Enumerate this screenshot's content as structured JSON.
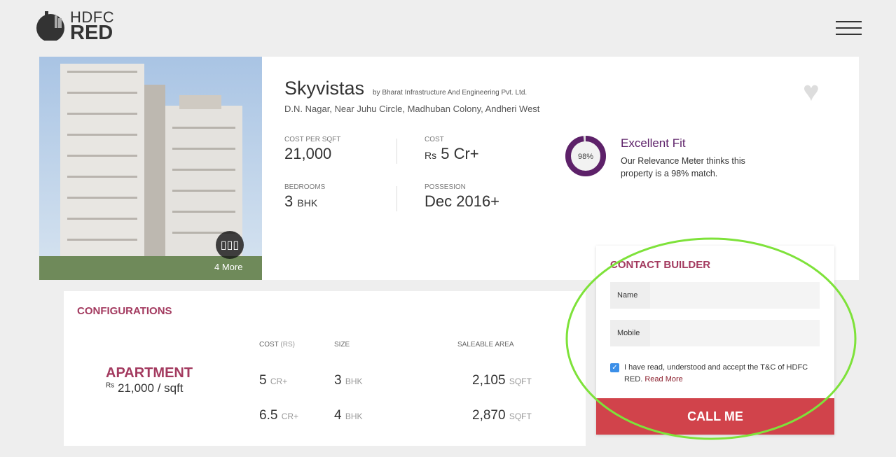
{
  "header": {
    "logo_line1": "HDFC",
    "logo_line2": "RED",
    "menu_icon": "hamburger-icon"
  },
  "property": {
    "name": "Skyvistas",
    "builder": "by Bharat Infrastructure And Engineering Pvt. Ltd.",
    "address": "D.N. Nagar, Near Juhu Circle, Madhuban Colony, Andheri West",
    "gallery_more": "4 More",
    "stats": {
      "cost_per_sqft_label": "COST PER SQFT",
      "cost_per_sqft": "21,000",
      "cost_label": "COST",
      "cost_prefix": "Rs",
      "cost": "5 Cr+",
      "bedrooms_label": "BEDROOMS",
      "bedrooms": "3",
      "bedrooms_unit": "BHK",
      "possession_label": "POSSESION",
      "possession": "Dec 2016+"
    },
    "relevance": {
      "percent": 98,
      "percent_label": "98%",
      "title": "Excellent Fit",
      "description": "Our Relevance Meter thinks this property is a 98% match.",
      "color": "#5d2169"
    }
  },
  "configurations": {
    "title": "CONFIGURATIONS",
    "type": "APARTMENT",
    "rate_prefix": "Rs",
    "rate": "21,000 / sqft",
    "headers": {
      "cost": "COST",
      "cost_unit": "(RS)",
      "size": "SIZE",
      "area": "SALEABLE AREA"
    },
    "rows": [
      {
        "cost": "5",
        "cost_unit": "CR+",
        "size": "3",
        "size_unit": "BHK",
        "area": "2,105",
        "area_unit": "SQFT"
      },
      {
        "cost": "6.5",
        "cost_unit": "CR+",
        "size": "4",
        "size_unit": "BHK",
        "area": "2,870",
        "area_unit": "SQFT"
      }
    ]
  },
  "contact": {
    "title": "CONTACT BUILDER",
    "name_label": "Name",
    "name_value": "",
    "mobile_label": "Mobile",
    "mobile_value": "",
    "terms": "I have read, understood and accept the T&C of HDFC RED.",
    "read_more": "Read More",
    "terms_checked": true,
    "call_button": "CALL ME",
    "button_color": "#d1434b"
  },
  "annotation": {
    "color": "#7ee23a"
  }
}
